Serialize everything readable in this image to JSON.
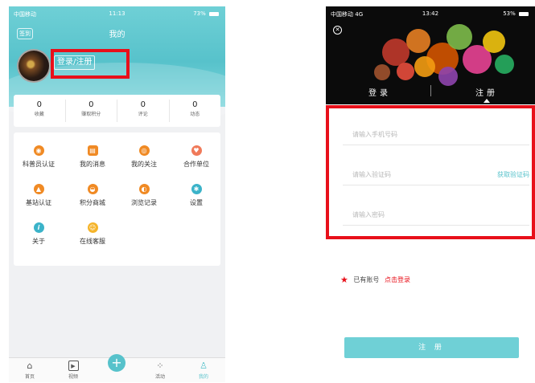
{
  "left": {
    "status": {
      "carrier": "中国移动",
      "time": "11:13",
      "battery": "73%"
    },
    "header": {
      "sign_label": "签到",
      "title": "我的"
    },
    "login_button": "登录/注册",
    "stats": [
      {
        "value": "0",
        "label": "收藏"
      },
      {
        "value": "0",
        "label": "赚取积分"
      },
      {
        "value": "0",
        "label": "评论"
      },
      {
        "value": "0",
        "label": "动态"
      }
    ],
    "menu": [
      {
        "label": "科普员认证",
        "icon": "shield-badge-icon",
        "color": "#f08a24",
        "glyph": "◉"
      },
      {
        "label": "我的消息",
        "icon": "message-icon",
        "color": "#f08a24",
        "glyph": "▤"
      },
      {
        "label": "我的关注",
        "icon": "person-follow-icon",
        "color": "#f08a24",
        "glyph": "◎"
      },
      {
        "label": "合作单位",
        "icon": "handshake-icon",
        "color": "#f07a5a",
        "glyph": "♥"
      },
      {
        "label": "基站认证",
        "icon": "station-badge-icon",
        "color": "#f08a24",
        "glyph": "▲"
      },
      {
        "label": "积分商城",
        "icon": "shop-basket-icon",
        "color": "#f08a24",
        "glyph": "◒"
      },
      {
        "label": "浏览记录",
        "icon": "history-icon",
        "color": "#f08a24",
        "glyph": "◐"
      },
      {
        "label": "设置",
        "icon": "gear-icon",
        "color": "#3bb3c9",
        "glyph": "✱"
      },
      {
        "label": "关于",
        "icon": "info-icon",
        "color": "#3bb3c9",
        "glyph": "i"
      },
      {
        "label": "在线客服",
        "icon": "customer-service-icon",
        "color": "#f5b42a",
        "glyph": "☺"
      }
    ],
    "tabbar": [
      {
        "label": "首页",
        "icon": "home-icon",
        "glyph": "⌂"
      },
      {
        "label": "视频",
        "icon": "video-icon",
        "glyph": "▶"
      },
      {
        "label": "活动",
        "icon": "activity-icon",
        "glyph": "⁘"
      },
      {
        "label": "我的",
        "icon": "profile-icon",
        "glyph": "♙"
      }
    ]
  },
  "right": {
    "status": {
      "carrier": "中国移动",
      "network": "4G",
      "time": "13:42",
      "battery": "53%"
    },
    "tabs": {
      "login": "登录",
      "register": "注册"
    },
    "fields": {
      "phone_placeholder": "请输入手机号码",
      "code_placeholder": "请输入验证码",
      "get_code": "获取验证码",
      "password_placeholder": "请输入密码"
    },
    "account": {
      "text": "已有账号",
      "link": "点击登录"
    },
    "register_button": "注 册"
  },
  "colors": {
    "accent": "#57c2cb",
    "highlight_box": "#e8101a",
    "brand_orange": "#f08a24"
  }
}
